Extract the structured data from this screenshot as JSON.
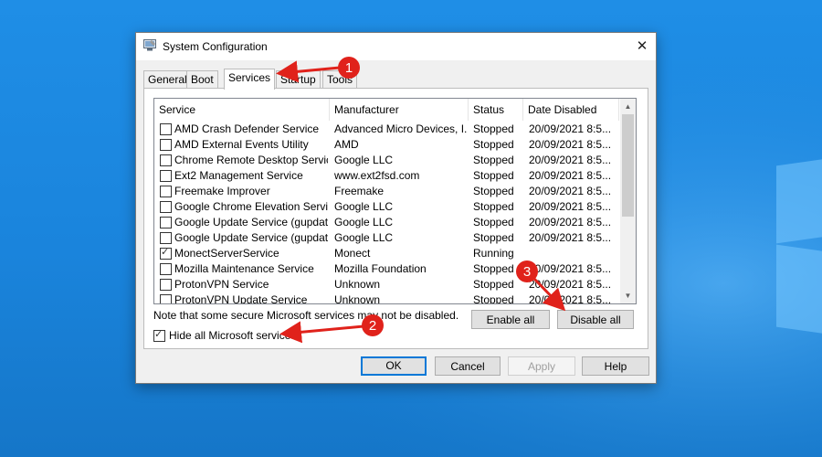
{
  "window": {
    "title": "System Configuration",
    "close_glyph": "✕"
  },
  "tabs": [
    "General",
    "Boot",
    "Services",
    "Startup",
    "Tools"
  ],
  "active_tab": "Services",
  "services_table": {
    "columns": [
      "Service",
      "Manufacturer",
      "Status",
      "Date Disabled"
    ],
    "rows": [
      {
        "checked": false,
        "service": "AMD Crash Defender Service",
        "manufacturer": "Advanced Micro Devices, I...",
        "status": "Stopped",
        "date_disabled": "20/09/2021 8:5..."
      },
      {
        "checked": false,
        "service": "AMD External Events Utility",
        "manufacturer": "AMD",
        "status": "Stopped",
        "date_disabled": "20/09/2021 8:5..."
      },
      {
        "checked": false,
        "service": "Chrome Remote Desktop Service",
        "manufacturer": "Google LLC",
        "status": "Stopped",
        "date_disabled": "20/09/2021 8:5..."
      },
      {
        "checked": false,
        "service": "Ext2 Management Service",
        "manufacturer": "www.ext2fsd.com",
        "status": "Stopped",
        "date_disabled": "20/09/2021 8:5..."
      },
      {
        "checked": false,
        "service": "Freemake Improver",
        "manufacturer": "Freemake",
        "status": "Stopped",
        "date_disabled": "20/09/2021 8:5..."
      },
      {
        "checked": false,
        "service": "Google Chrome Elevation Servic...",
        "manufacturer": "Google LLC",
        "status": "Stopped",
        "date_disabled": "20/09/2021 8:5..."
      },
      {
        "checked": false,
        "service": "Google Update Service (gupdate)",
        "manufacturer": "Google LLC",
        "status": "Stopped",
        "date_disabled": "20/09/2021 8:5..."
      },
      {
        "checked": false,
        "service": "Google Update Service (gupdatem)",
        "manufacturer": "Google LLC",
        "status": "Stopped",
        "date_disabled": "20/09/2021 8:5..."
      },
      {
        "checked": true,
        "service": "MonectServerService",
        "manufacturer": "Monect",
        "status": "Running",
        "date_disabled": ""
      },
      {
        "checked": false,
        "service": "Mozilla Maintenance Service",
        "manufacturer": "Mozilla Foundation",
        "status": "Stopped",
        "date_disabled": "20/09/2021 8:5..."
      },
      {
        "checked": false,
        "service": "ProtonVPN Service",
        "manufacturer": "Unknown",
        "status": "Stopped",
        "date_disabled": "20/09/2021 8:5..."
      },
      {
        "checked": false,
        "service": "ProtonVPN Update Service",
        "manufacturer": "Unknown",
        "status": "Stopped",
        "date_disabled": "20/09/2021 8:5..."
      }
    ]
  },
  "note": "Note that some secure Microsoft services may not be disabled.",
  "enable_all_label": "Enable all",
  "disable_all_label": "Disable all",
  "hide_microsoft": {
    "label": "Hide all Microsoft services",
    "checked": true
  },
  "footer_buttons": {
    "ok": "OK",
    "cancel": "Cancel",
    "apply": "Apply",
    "help": "Help"
  },
  "annotations": [
    {
      "number": "1",
      "target": "Services tab"
    },
    {
      "number": "2",
      "target": "Hide all Microsoft services"
    },
    {
      "number": "3",
      "target": "Disable all"
    }
  ],
  "colors": {
    "annotation_red": "#e0221b",
    "desktop_blue": "#1a84dc",
    "focus_blue": "#0078d7"
  }
}
